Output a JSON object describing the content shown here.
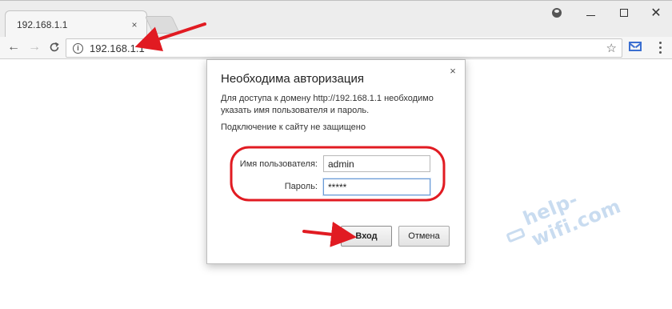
{
  "tab": {
    "title": "192.168.1.1",
    "close": "×"
  },
  "window_controls": {
    "minimize": "minimize",
    "maximize": "maximize",
    "close": "✕"
  },
  "toolbar": {
    "back": "←",
    "forward": "→",
    "reload": "C",
    "url": "192.168.1.1",
    "info": "i",
    "star": "☆"
  },
  "dialog": {
    "title": "Необходима авторизация",
    "description": "Для доступа к домену http://192.168.1.1 необходимо указать имя пользователя и пароль.",
    "warning": "Подключение к сайту не защищено",
    "close": "×",
    "username_label": "Имя пользователя:",
    "username_value": "admin",
    "password_label": "Пароль:",
    "password_value": "*****",
    "login_button": "Вход",
    "cancel_button": "Отмена"
  },
  "watermark": {
    "text": "help-wifi.com"
  },
  "colors": {
    "annotation": "#e11b22",
    "watermark": "#c9dcf0",
    "focus_border": "#6b9bd6"
  }
}
